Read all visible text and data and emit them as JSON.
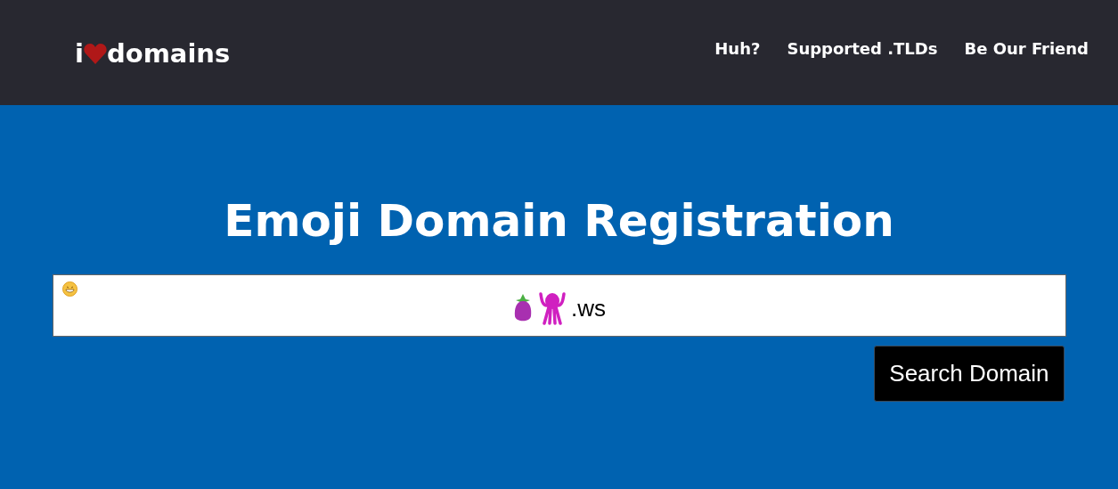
{
  "header": {
    "logo": {
      "prefix": "i",
      "suffix": "domains"
    },
    "nav": [
      "Huh?",
      "Supported .TLDs",
      "Be Our Friend"
    ]
  },
  "hero": {
    "title": "Emoji Domain Registration",
    "search": {
      "value": ".ws"
    },
    "button": "Search Domain"
  }
}
